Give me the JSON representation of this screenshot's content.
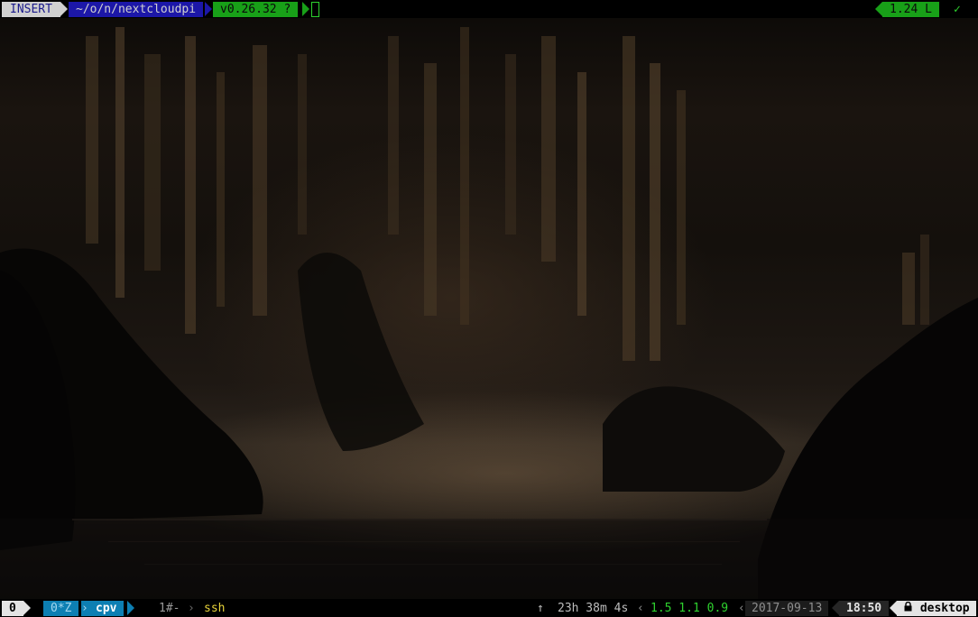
{
  "statusline": {
    "mode": "INSERT",
    "path": "~/o/n/nextcloudpi",
    "git_version": "v0.26.32 ?",
    "line_info": "1.24 L",
    "check": "✓"
  },
  "tmux": {
    "session": "0",
    "windows": [
      {
        "index": "0*Z",
        "name": "cpv"
      },
      {
        "index": "1#-",
        "name": "ssh"
      }
    ],
    "up_arrow": "↑",
    "uptime": "23h 38m 4s",
    "load": "1.5 1.1 0.9",
    "date": "2017-09-13",
    "time": "18:50",
    "host": "desktop",
    "lock_icon": "lock-icon"
  },
  "colors": {
    "mode_bg": "#d0d0d0",
    "path_bg": "#1c17a8",
    "git_bg": "#18a018",
    "window_active_bg": "#0d7fb3",
    "load_fg": "#2ed12e",
    "window_ssh_fg": "#e6d23a"
  }
}
